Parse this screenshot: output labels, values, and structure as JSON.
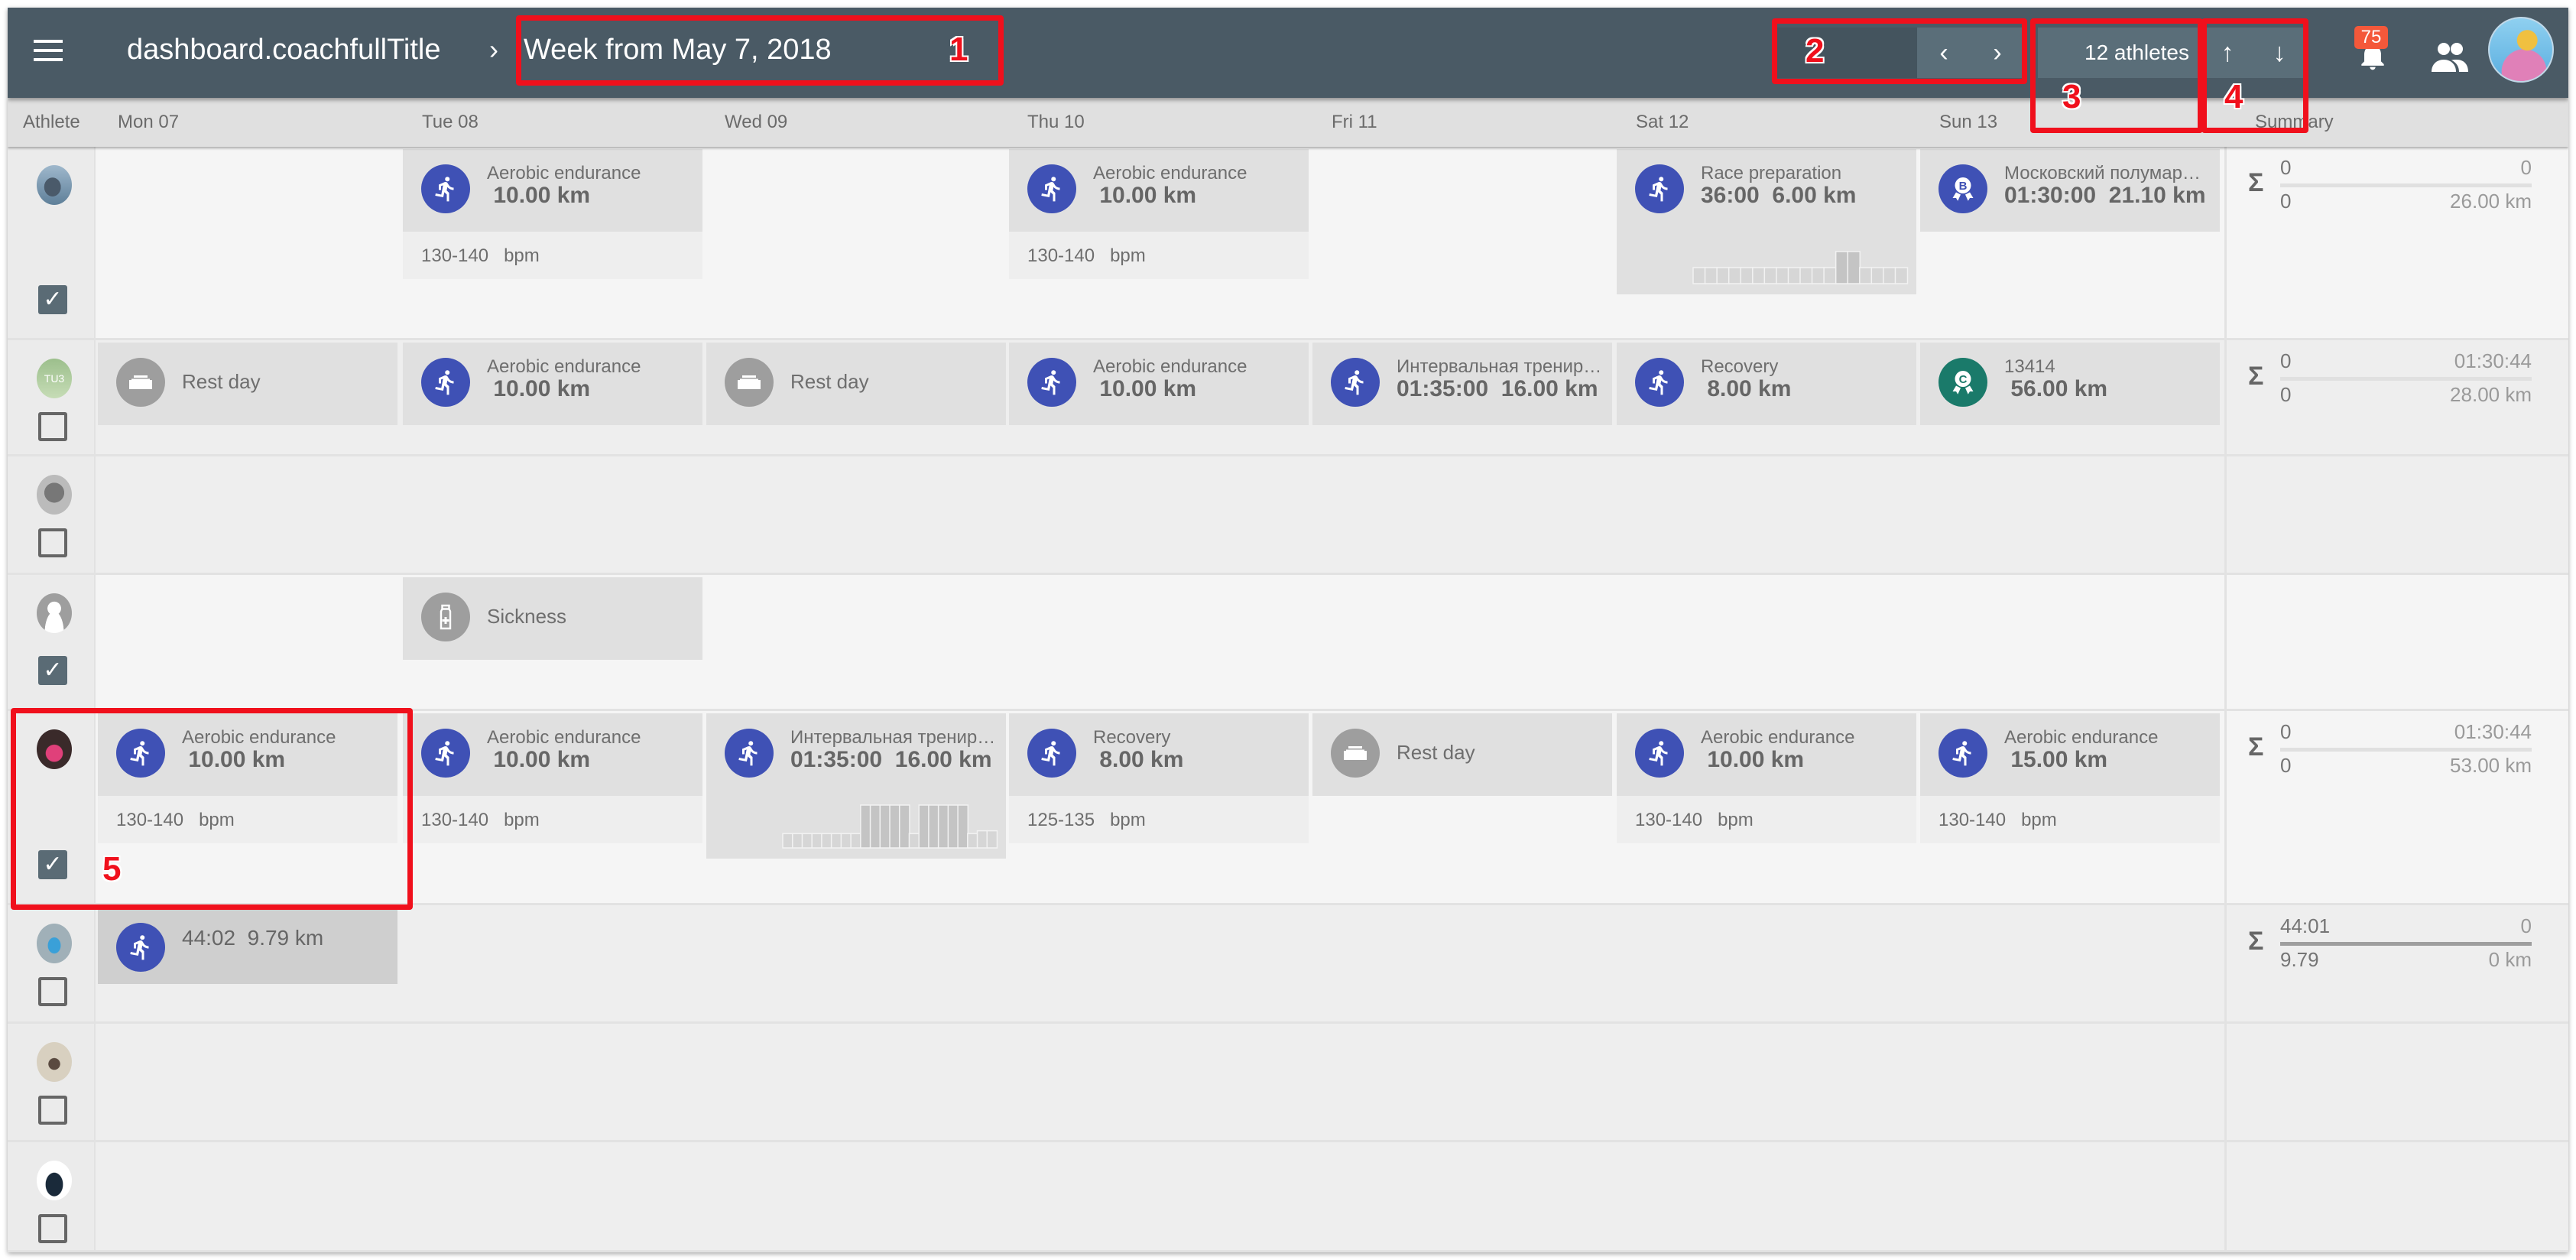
{
  "appbar": {
    "breadcrumb_root": "dashboard.coachfullTitle",
    "breadcrumb_separator": "›",
    "breadcrumb_current": "Week from May 7, 2018",
    "prev_label": "‹",
    "next_label": "›",
    "athletes_count": "12 athletes",
    "sort_up": "↑",
    "sort_down": "↓",
    "notifications_count": "75",
    "menu_icon": "menu-icon",
    "bell_icon": "bell-icon",
    "people_icon": "people-icon"
  },
  "columns": [
    "Athlete",
    "Mon 07",
    "Tue 08",
    "Wed 09",
    "Thu 10",
    "Fri 11",
    "Sat 12",
    "Sun 13",
    "Summary"
  ],
  "colors": {
    "appbar": "#4a5a65",
    "run_icon": "#3f51b5",
    "rest_icon": "#9e9e9e",
    "competition_c": "#1a7a6a",
    "badge": "#f4583a",
    "annotation": "#f0101c"
  },
  "annotations": [
    {
      "label": "1",
      "target": "week-title"
    },
    {
      "label": "2",
      "target": "week-navigation"
    },
    {
      "label": "3",
      "target": "athletes-count"
    },
    {
      "label": "4",
      "target": "sort-arrows"
    },
    {
      "label": "5",
      "target": "athlete-row-5-monday"
    }
  ],
  "rows": [
    {
      "avatar": "whale-photo",
      "checked": true,
      "summary": {
        "top_left": "0",
        "top_right": "0",
        "bottom_left": "0",
        "bottom_right": "26.00 km",
        "progress": 0
      },
      "cards": [
        {
          "day": 1,
          "icon": "run",
          "title": "Aerobic endurance",
          "main": " 10.00 km",
          "bpm": "130-140   bpm"
        },
        {
          "day": 3,
          "icon": "run",
          "title": "Aerobic endurance",
          "main": " 10.00 km",
          "bpm": "130-140   bpm"
        },
        {
          "day": 5,
          "icon": "run",
          "title": "Race preparation",
          "main": "36:00  6.00 km",
          "chart": [
            1,
            1,
            1,
            1,
            1,
            1,
            1,
            1,
            1,
            1,
            1,
            1,
            2,
            2,
            1,
            1,
            1,
            1
          ]
        },
        {
          "day": 6,
          "icon": "competition-b",
          "title": "Московский полумар…",
          "main": "01:30:00  21.10 km"
        }
      ]
    },
    {
      "avatar": "initials-tu3",
      "initials": "TU3",
      "checked": false,
      "summary": {
        "top_left": "0",
        "top_right": "01:30:44",
        "bottom_left": "0",
        "bottom_right": "28.00 km",
        "progress": 0
      },
      "cards": [
        {
          "day": 0,
          "icon": "rest",
          "single": "Rest day"
        },
        {
          "day": 1,
          "icon": "run",
          "title": "Aerobic endurance",
          "main": " 10.00 km"
        },
        {
          "day": 2,
          "icon": "rest",
          "single": "Rest day"
        },
        {
          "day": 3,
          "icon": "run",
          "title": "Aerobic endurance",
          "main": " 10.00 km"
        },
        {
          "day": 4,
          "icon": "run",
          "title": "Интервальная тренир…",
          "main": "01:35:00  16.00 km"
        },
        {
          "day": 5,
          "icon": "run",
          "title": "Recovery",
          "main": " 8.00 km"
        },
        {
          "day": 6,
          "icon": "competition-c",
          "title": "13414",
          "main": " 56.00 km"
        }
      ]
    },
    {
      "avatar": "man-photo",
      "checked": false,
      "summary": null,
      "cards": []
    },
    {
      "avatar": "default-user",
      "checked": true,
      "summary": null,
      "cards": [
        {
          "day": 1,
          "icon": "sickness",
          "single": "Sickness"
        }
      ]
    },
    {
      "avatar": "pink-photo",
      "checked": true,
      "summary": {
        "top_left": "0",
        "top_right": "01:30:44",
        "bottom_left": "0",
        "bottom_right": "53.00 km",
        "progress": 0
      },
      "cards": [
        {
          "day": 0,
          "icon": "run",
          "title": "Aerobic endurance",
          "main": " 10.00 km",
          "bpm": "130-140   bpm"
        },
        {
          "day": 1,
          "icon": "run",
          "title": "Aerobic endurance",
          "main": " 10.00 km",
          "bpm": "130-140   bpm"
        },
        {
          "day": 2,
          "icon": "run",
          "title": "Интервальная тренир…",
          "main": "01:35:00  16.00 km",
          "chart": [
            1,
            1,
            1,
            1,
            1,
            1,
            1,
            1,
            3,
            3,
            3,
            3,
            3,
            1,
            3,
            3,
            3,
            3,
            3,
            1,
            1.2,
            1.2
          ]
        },
        {
          "day": 3,
          "icon": "run",
          "title": "Recovery",
          "main": " 8.00 km",
          "bpm": "125-135   bpm"
        },
        {
          "day": 4,
          "icon": "rest",
          "single": "Rest day"
        },
        {
          "day": 5,
          "icon": "run",
          "title": "Aerobic endurance",
          "main": " 10.00 km",
          "bpm": "130-140   bpm"
        },
        {
          "day": 6,
          "icon": "run",
          "title": "Aerobic endurance",
          "main": " 15.00 km",
          "bpm": "130-140   bpm"
        }
      ]
    },
    {
      "avatar": "runner-photo",
      "checked": false,
      "summary": {
        "top_left": "44:01",
        "top_right": "0",
        "bottom_left": "9.79",
        "bottom_right": "0 km",
        "progress": 1
      },
      "cards": [
        {
          "day": 0,
          "icon": "run",
          "completed": true,
          "title": "",
          "main": "44:02  9.79 km",
          "main_only": true
        }
      ]
    },
    {
      "avatar": "cat-photo",
      "checked": false,
      "summary": null,
      "cards": []
    },
    {
      "avatar": "triathlete-photo",
      "checked": false,
      "summary": null,
      "cards": []
    }
  ]
}
